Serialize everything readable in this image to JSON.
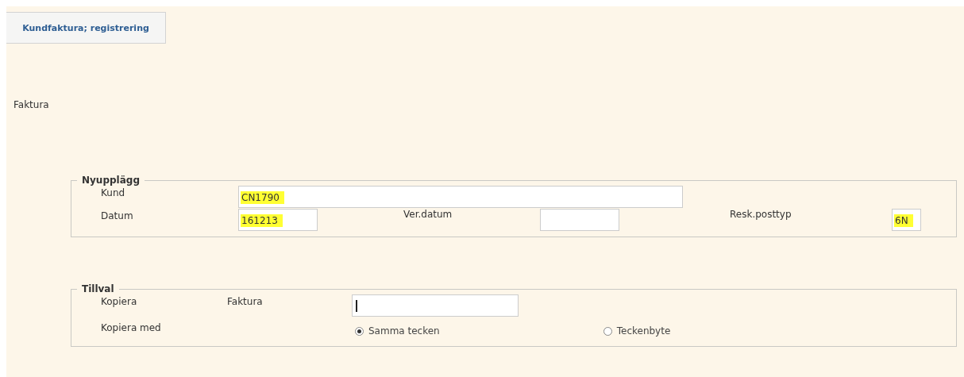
{
  "tab": {
    "label": "Kundfaktura; registrering",
    "selected": true
  },
  "heading": "Faktura",
  "nyupplagg": {
    "legend": "Nyupplägg",
    "kund": {
      "label": "Kund",
      "value": "CN1790",
      "highlighted": true
    },
    "datum": {
      "label": "Datum",
      "value": "161213",
      "highlighted": true
    },
    "ver_datum": {
      "label": "Ver.datum"
    },
    "resk_posttyp": {
      "label": "Resk.posttyp",
      "value": "6N",
      "highlighted": true
    }
  },
  "tillval": {
    "legend": "Tillval",
    "kopiera": {
      "label": "Kopiera",
      "sublabel": "Faktura",
      "focused": true
    },
    "kopiera_med": {
      "label": "Kopiera med",
      "options": [
        {
          "label": "Samma tecken",
          "selected": true
        },
        {
          "label": "Teckenbyte",
          "selected": false
        }
      ]
    }
  }
}
